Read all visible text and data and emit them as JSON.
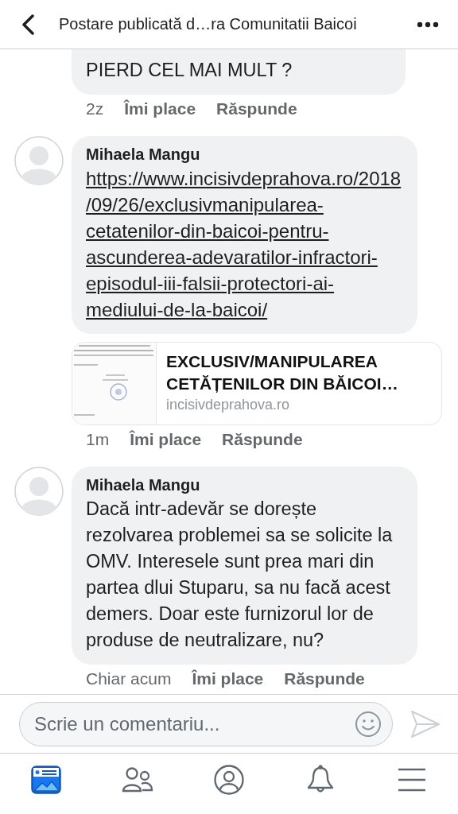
{
  "header": {
    "title": "Postare publicată d…ra Comunitatii Baicoi"
  },
  "comments": [
    {
      "kind": "text",
      "text": "PIERD CEL MAI MULT ?",
      "time": "2z",
      "like": "Îmi place",
      "reply": "Răspunde"
    },
    {
      "kind": "link",
      "author": "Mihaela Mangu",
      "text": "https://www.incisivdeprahova.ro/2018/09/26/exclusivmanipularea-cetatenilor-din-baicoi-pentru-ascunderea-adevaratilor-infractori-episodul-iii-falsii-protectori-ai-mediului-de-la-baicoi/",
      "preview": {
        "title": "EXCLUSIV/MANIPULAREA CETĂȚENILOR DIN BĂICOI…",
        "domain": "incisivdeprahova.ro"
      },
      "time": "1m",
      "like": "Îmi place",
      "reply": "Răspunde"
    },
    {
      "kind": "text",
      "author": "Mihaela Mangu",
      "text": "Dacă intr-adevăr se dorește rezolvarea problemei sa se solicite la OMV. Interesele sunt prea mari din partea dlui Stuparu, sa nu facă acest demers. Doar este furnizorul lor de produse de neutralizare, nu?",
      "time": "Chiar acum",
      "like": "Îmi place",
      "reply": "Răspunde"
    }
  ],
  "composer": {
    "placeholder": "Scrie un comentariu..."
  },
  "tabs": [
    {
      "kind": "feed",
      "selected": true
    },
    {
      "kind": "friends",
      "selected": false
    },
    {
      "kind": "profile",
      "selected": false
    },
    {
      "kind": "notifications",
      "selected": false
    },
    {
      "kind": "menu",
      "selected": false
    }
  ]
}
